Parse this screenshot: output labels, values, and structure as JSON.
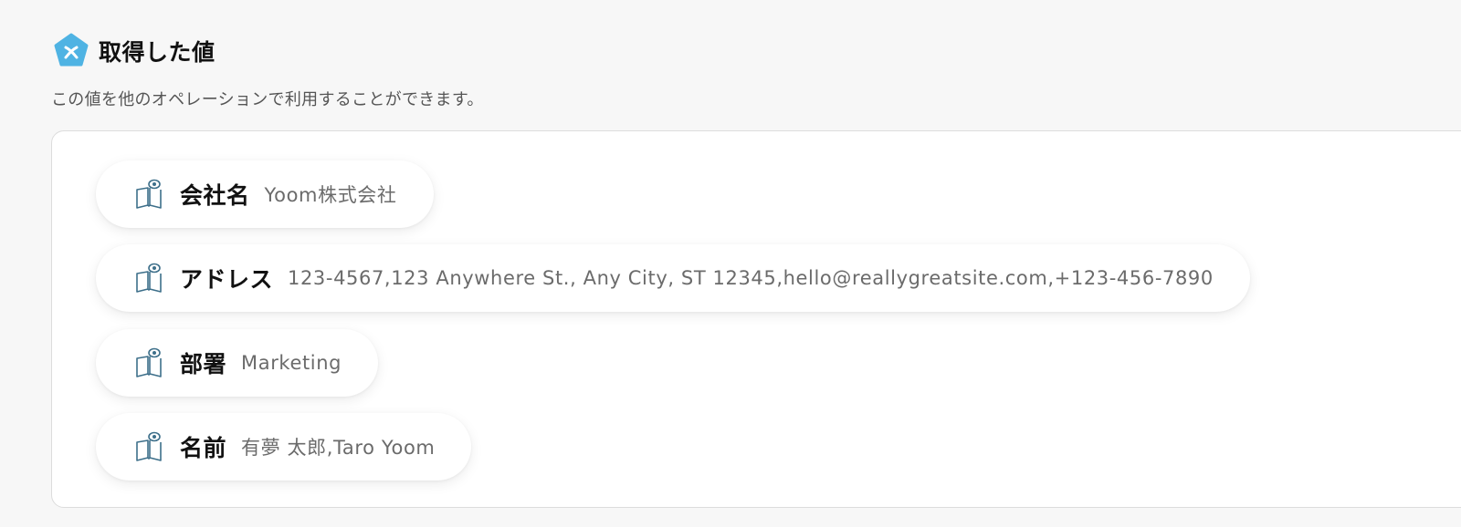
{
  "section": {
    "title": "取得した値",
    "description": "この値を他のオペレーションで利用することができます。",
    "header_icon": "yoom-pentagon-icon",
    "accent_color": "#4fb3e3"
  },
  "values": [
    {
      "label": "会社名",
      "value": "Yoom株式会社",
      "icon": "book-eye-icon"
    },
    {
      "label": "アドレス",
      "value": "123-4567,123 Anywhere St., Any City, ST 12345,hello@reallygreatsite.com,+123-456-7890",
      "icon": "book-eye-icon"
    },
    {
      "label": "部署",
      "value": "Marketing",
      "icon": "book-eye-icon"
    },
    {
      "label": "名前",
      "value": "有夢 太郎,Taro Yoom",
      "icon": "book-eye-icon"
    }
  ]
}
